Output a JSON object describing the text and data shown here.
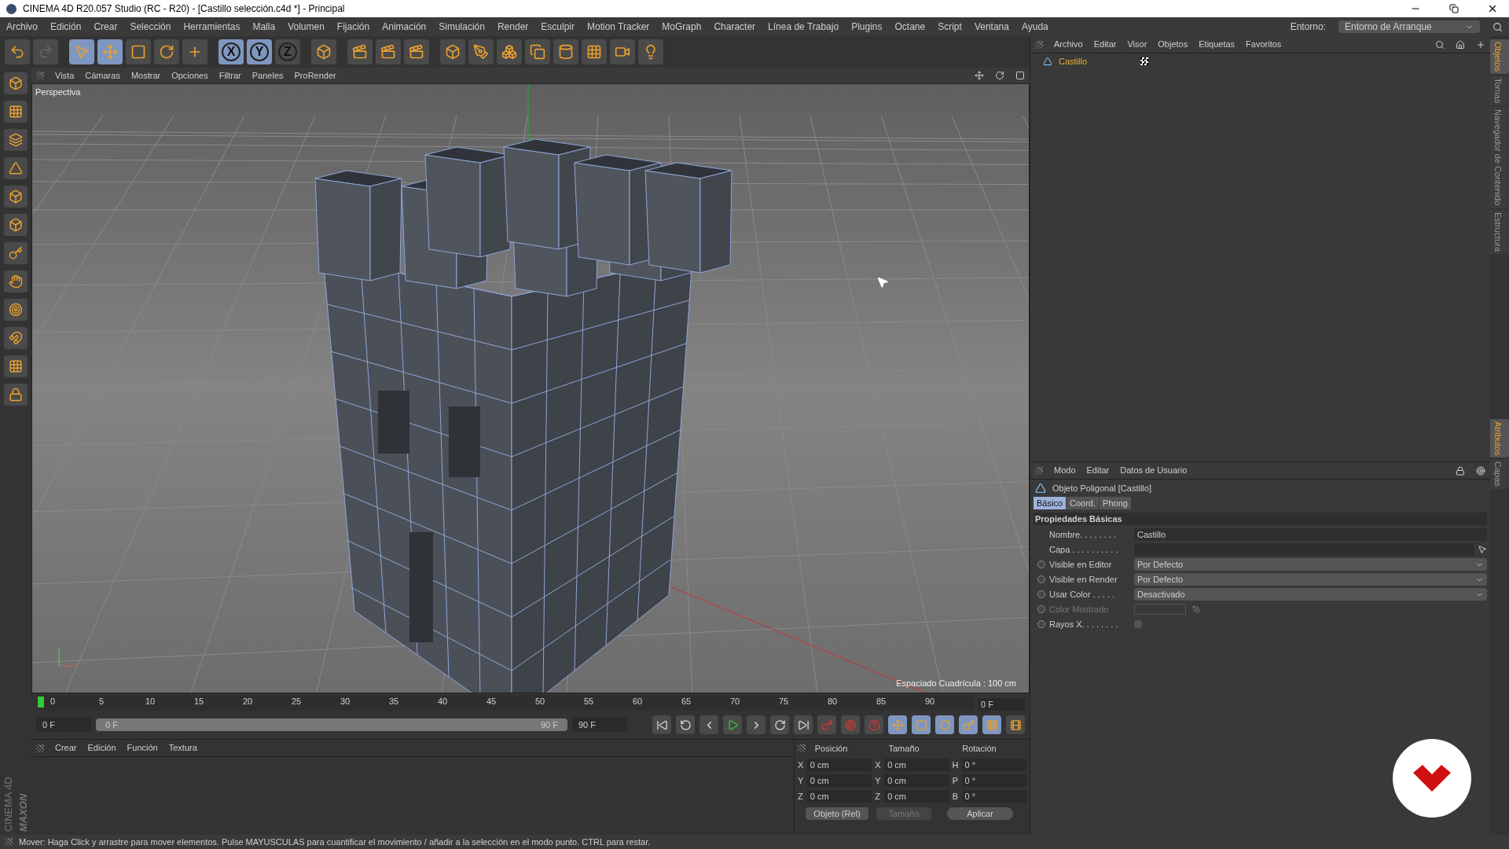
{
  "window": {
    "title": "CINEMA 4D R20.057 Studio (RC - R20) - [Castillo selección.c4d *] - Principal"
  },
  "menu": [
    "Archivo",
    "Edición",
    "Crear",
    "Selección",
    "Herramientas",
    "Malla",
    "Volumen",
    "Fijación",
    "Animación",
    "Simulación",
    "Render",
    "Esculpir",
    "Motion Tracker",
    "MoGraph",
    "Character",
    "Línea de Trabajo",
    "Plugins",
    "Octane",
    "Script",
    "Ventana",
    "Ayuda"
  ],
  "environment": {
    "label": "Entorno:",
    "value": "Entorno de Arranque"
  },
  "toolbar": [
    {
      "kind": "undo",
      "selected": false
    },
    {
      "kind": "redo",
      "selected": false
    },
    {
      "kind": "select",
      "selected": true
    },
    {
      "kind": "move",
      "selected": true
    },
    {
      "kind": "scale",
      "selected": false
    },
    {
      "kind": "rotate",
      "selected": false
    },
    {
      "kind": "add",
      "selected": false
    },
    {
      "kind": "axis",
      "label": "X",
      "selected": true
    },
    {
      "kind": "axis",
      "label": "Y",
      "selected": true
    },
    {
      "kind": "axis",
      "label": "Z",
      "selected": false
    },
    {
      "kind": "coords",
      "selected": false
    },
    {
      "kind": "render",
      "selected": false
    },
    {
      "kind": "render",
      "selected": false
    },
    {
      "kind": "render",
      "selected": false
    },
    {
      "kind": "cube",
      "selected": false
    },
    {
      "kind": "pen",
      "selected": false
    },
    {
      "kind": "subdivide",
      "selected": false
    },
    {
      "kind": "cloner",
      "selected": false
    },
    {
      "kind": "deformer",
      "selected": false
    },
    {
      "kind": "floor",
      "selected": false
    },
    {
      "kind": "camera",
      "selected": false
    },
    {
      "kind": "light",
      "selected": false
    }
  ],
  "viewport": {
    "menu": [
      "Vista",
      "Cámaras",
      "Mostrar",
      "Opciones",
      "Filtrar",
      "Paneles",
      "ProRender"
    ],
    "label": "Perspectiva",
    "grid_spacing": "Espaciado Cuadrícula : 100 cm"
  },
  "timeline": {
    "ticks": [
      "0",
      "5",
      "10",
      "15",
      "20",
      "25",
      "30",
      "35",
      "40",
      "45",
      "50",
      "55",
      "60",
      "65",
      "70",
      "75",
      "80",
      "85",
      "90"
    ],
    "current_frame": "0 F",
    "start": "0 F",
    "range_slider": {
      "level": 1
    },
    "range_start": "0 F",
    "range_end": "90 F",
    "end": "90 F"
  },
  "materials": {
    "menu": [
      "Crear",
      "Edición",
      "Función",
      "Textura"
    ]
  },
  "brand": [
    "MAXON",
    "CINEMA 4D"
  ],
  "objects": {
    "menu": [
      "Archivo",
      "Editar",
      "Visor",
      "Objetos",
      "Etiquetas",
      "Favoritos"
    ],
    "items": [
      {
        "name": "Castillo",
        "selected": true
      }
    ]
  },
  "attributes": {
    "menu": [
      "Modo",
      "Editar",
      "Datos de Usuario"
    ],
    "title": "Objeto Poligonal [Castillo]",
    "tabs": [
      {
        "label": "Básico",
        "selected": true
      },
      {
        "label": "Coord.",
        "selected": false
      },
      {
        "label": "Phong",
        "selected": false
      }
    ],
    "section": "Propiedades Básicas",
    "properties": [
      {
        "kind": "text",
        "label": "Nombre. . . . . . . .",
        "value": "Castillo",
        "keyframe": false,
        "disabled": false
      },
      {
        "kind": "link",
        "label": "Capa . . . . . . . . . .",
        "keyframe": false,
        "disabled": false
      },
      {
        "kind": "dropdown",
        "label": "Visible en Editor",
        "value": "Por Defecto",
        "keyframe": true,
        "disabled": false
      },
      {
        "kind": "dropdown",
        "label": "Visible en Render",
        "value": "Por Defecto",
        "keyframe": true,
        "disabled": false
      },
      {
        "kind": "dropdown",
        "label": "Usar Color . . . . .",
        "value": "Desactivado",
        "keyframe": true,
        "disabled": false
      },
      {
        "kind": "color",
        "label": "Color Mostrado",
        "keyframe": true,
        "disabled": true
      },
      {
        "kind": "checkbox",
        "label": "Rayos X. . . . . . . .",
        "checked": false,
        "keyframe": true,
        "disabled": false
      }
    ]
  },
  "coordinates": {
    "headers": [
      "Posición",
      "Tamaño",
      "Rotación"
    ],
    "rows": [
      {
        "cells": [
          {
            "axis": "X",
            "value": "0 cm"
          },
          {
            "axis": "X",
            "value": "0 cm"
          },
          {
            "axis": "H",
            "value": "0 °"
          }
        ]
      },
      {
        "cells": [
          {
            "axis": "Y",
            "value": "0 cm"
          },
          {
            "axis": "Y",
            "value": "0 cm"
          },
          {
            "axis": "P",
            "value": "0 °"
          }
        ]
      },
      {
        "cells": [
          {
            "axis": "Z",
            "value": "0 cm"
          },
          {
            "axis": "Z",
            "value": "0 cm"
          },
          {
            "axis": "B",
            "value": "0 °"
          }
        ]
      }
    ],
    "mode": "Objeto (Rel)",
    "size_mode": "Tamaño",
    "apply": "Aplicar"
  },
  "side_tabs_top": [
    {
      "label": "Objetos",
      "selected": true
    },
    {
      "label": "Tomas",
      "selected": false
    },
    {
      "label": "Navegador de Contenido",
      "selected": false
    },
    {
      "label": "Estructura",
      "selected": false
    }
  ],
  "side_tabs_bottom": [
    {
      "label": "Atributos",
      "selected": true
    },
    {
      "label": "Capas",
      "selected": false
    }
  ],
  "status_bar": "Mover: Haga Click y arrastre para mover elementos. Pulse MAYUSCULAS para cuantificar el movimiento / añadir a la selección en el modo punto. CTRL para restar."
}
